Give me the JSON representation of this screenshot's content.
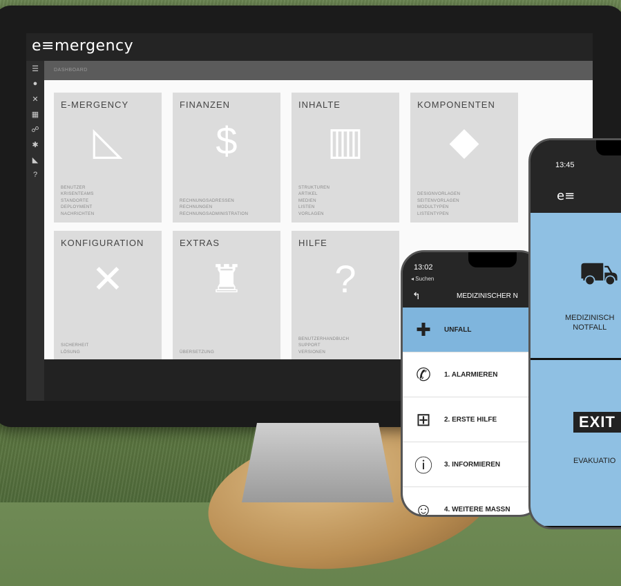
{
  "app": {
    "logo": "e≡mergency",
    "breadcrumb": "DASHBOARD"
  },
  "sidebar_icons": [
    "menu-icon",
    "globe-icon",
    "tools-icon",
    "list-icon",
    "users-icon",
    "settings-icon",
    "megaphone-icon",
    "help-icon"
  ],
  "tiles": [
    {
      "title": "E-MERGENCY",
      "icon": "phone-triangle-icon",
      "links": [
        "BENUTZER",
        "KRISENTEAMS",
        "STANDORTE",
        "DEPLOYMENT",
        "NACHRICHTEN"
      ]
    },
    {
      "title": "FINANZEN",
      "icon": "dollar-icon",
      "links": [
        "RECHNUNGSADRESSEN",
        "RECHNUNGEN",
        "RECHNUNGSADMINISTRATION"
      ]
    },
    {
      "title": "INHALTE",
      "icon": "book-icon",
      "links": [
        "STRUKTUREN",
        "ARTIKEL",
        "MEDIEN",
        "LISTEN",
        "VORLAGEN"
      ]
    },
    {
      "title": "KOMPONENTEN",
      "icon": "cubes-icon",
      "links": [
        "DESIGNVORLAGEN",
        "SEITENVORLAGEN",
        "MODULTYPEN",
        "LISTENTYPEN"
      ]
    },
    {
      "title": "KONFIGURATION",
      "icon": "tools-icon",
      "links": [
        "SICHERHEIT",
        "LÖSUNG"
      ]
    },
    {
      "title": "EXTRAS",
      "icon": "magic-hat-icon",
      "links": [
        "ÜBERSETZUNG"
      ]
    },
    {
      "title": "HILFE",
      "icon": "question-icon",
      "links": [
        "BENUTZERHANDBUCH",
        "SUPPORT",
        "VERSIONEN"
      ]
    }
  ],
  "phone1": {
    "time": "13:02",
    "back": "◂ Suchen",
    "title": "MEDIZINISCHER N",
    "rows": [
      {
        "icon": "plus-icon",
        "label": "UNFALL"
      },
      {
        "icon": "phone-icon",
        "label": "1. ALARMIEREN"
      },
      {
        "icon": "first-aid-icon",
        "label": "2. ERSTE HILFE"
      },
      {
        "icon": "info-icon",
        "label": "3. INFORMIEREN"
      },
      {
        "icon": "head-icon",
        "label": "4. WEITERE MASSN"
      }
    ]
  },
  "phone2": {
    "time": "13:45",
    "logo": "e≡",
    "pane1_label_1": "MEDIZINISCH",
    "pane1_label_2": "NOTFALL",
    "exit": "EXIT",
    "pane2_label": "EVAKUATIO"
  },
  "colors": {
    "accent": "#8fc0e3",
    "active_row": "#7fb5dd",
    "tile": "#dcdcdc"
  }
}
